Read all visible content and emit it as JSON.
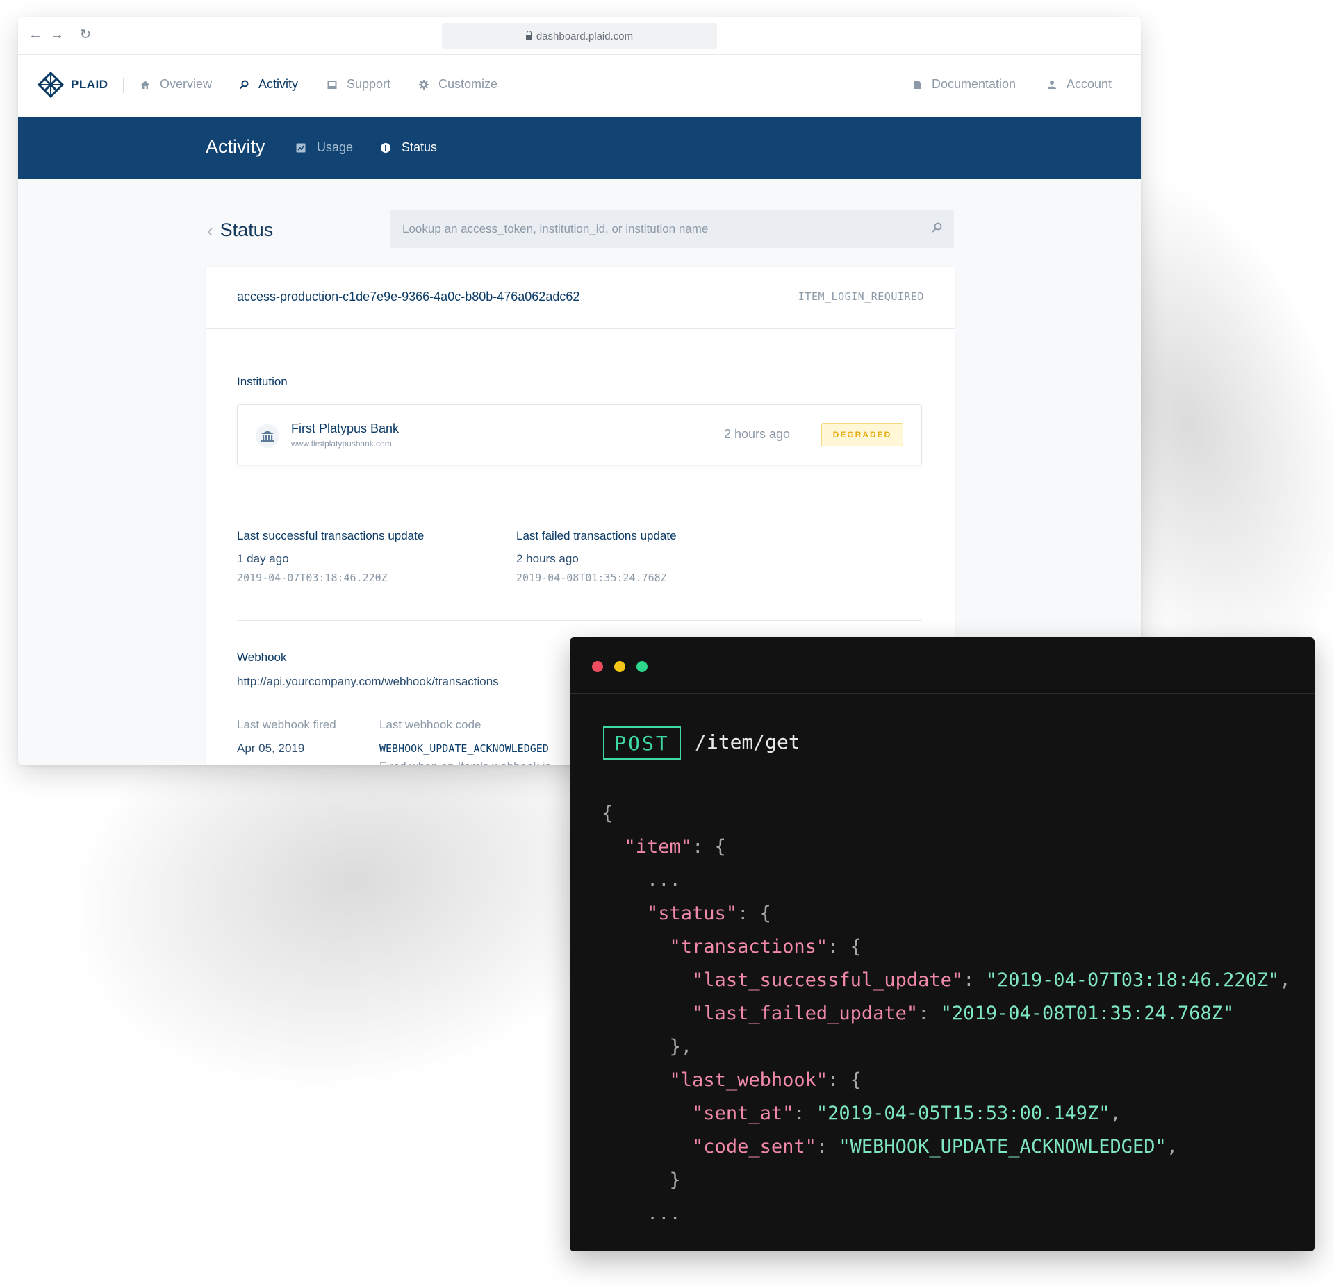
{
  "browser": {
    "url": "dashboard.plaid.com"
  },
  "topnav": {
    "brand": "PLAID",
    "items": [
      {
        "label": "Overview",
        "icon": "home-icon"
      },
      {
        "label": "Activity",
        "icon": "search-icon",
        "active": true
      },
      {
        "label": "Support",
        "icon": "support-icon"
      },
      {
        "label": "Customize",
        "icon": "gear-icon"
      }
    ],
    "right_items": [
      {
        "label": "Documentation",
        "icon": "document-icon"
      },
      {
        "label": "Account",
        "icon": "user-icon"
      }
    ]
  },
  "subbar": {
    "title": "Activity",
    "tabs": [
      {
        "label": "Usage",
        "icon": "chart-icon"
      },
      {
        "label": "Status",
        "icon": "info-icon",
        "active": true
      }
    ]
  },
  "page": {
    "title": "Status",
    "search_placeholder": "Lookup an access_token, institution_id, or institution name"
  },
  "item": {
    "access_token": "access-production-c1de7e9e-9366-4a0c-b80b-476a062adc62",
    "error_code": "ITEM_LOGIN_REQUIRED",
    "institution_label": "Institution",
    "institution": {
      "name": "First Platypus Bank",
      "url": "www.firstplatypusbank.com",
      "updated": "2 hours ago",
      "status": "DEGRADED"
    },
    "last_success": {
      "label": "Last successful transactions update",
      "relative": "1 day ago",
      "timestamp": "2019-04-07T03:18:46.220Z"
    },
    "last_failed": {
      "label": "Last failed transactions update",
      "relative": "2 hours ago",
      "timestamp": "2019-04-08T01:35:24.768Z"
    },
    "webhook": {
      "label": "Webhook",
      "url": "http://api.yourcompany.com/webhook/transactions",
      "fired_label": "Last webhook fired",
      "fired_value": "Apr 05, 2019",
      "code_label": "Last webhook code",
      "code_value": "WEBHOOK_UPDATE_ACKNOWLEDGED",
      "code_desc": "Fired when an Item's webhook is"
    }
  },
  "terminal": {
    "method": "POST",
    "endpoint": "/item/get",
    "lines": [
      {
        "indent": 0,
        "parts": [
          [
            "p",
            "{"
          ]
        ]
      },
      {
        "indent": 1,
        "parts": [
          [
            "k",
            "\"item\""
          ],
          [
            "p",
            ": {"
          ]
        ]
      },
      {
        "indent": 2,
        "parts": [
          [
            "p",
            "..."
          ]
        ]
      },
      {
        "indent": 2,
        "parts": [
          [
            "k",
            "\"status\""
          ],
          [
            "p",
            ": {"
          ]
        ]
      },
      {
        "indent": 3,
        "parts": [
          [
            "k",
            "\"transactions\""
          ],
          [
            "p",
            ": {"
          ]
        ]
      },
      {
        "indent": 4,
        "parts": [
          [
            "k",
            "\"last_successful_update\""
          ],
          [
            "p",
            ": "
          ],
          [
            "s",
            "\"2019-04-07T03:18:46.220Z\""
          ],
          [
            "p",
            ","
          ]
        ]
      },
      {
        "indent": 4,
        "parts": [
          [
            "k",
            "\"last_failed_update\""
          ],
          [
            "p",
            ": "
          ],
          [
            "s",
            "\"2019-04-08T01:35:24.768Z\""
          ]
        ]
      },
      {
        "indent": 3,
        "parts": [
          [
            "p",
            "},"
          ]
        ]
      },
      {
        "indent": 3,
        "parts": [
          [
            "k",
            "\"last_webhook\""
          ],
          [
            "p",
            ": {"
          ]
        ]
      },
      {
        "indent": 4,
        "parts": [
          [
            "k",
            "\"sent_at\""
          ],
          [
            "p",
            ": "
          ],
          [
            "s",
            "\"2019-04-05T15:53:00.149Z\""
          ],
          [
            "p",
            ","
          ]
        ]
      },
      {
        "indent": 4,
        "parts": [
          [
            "k",
            "\"code_sent\""
          ],
          [
            "p",
            ": "
          ],
          [
            "s",
            "\"WEBHOOK_UPDATE_ACKNOWLEDGED\""
          ],
          [
            "p",
            ","
          ]
        ]
      },
      {
        "indent": 3,
        "parts": [
          [
            "p",
            "}"
          ]
        ]
      },
      {
        "indent": 2,
        "parts": [
          [
            "p",
            "..."
          ]
        ]
      }
    ]
  },
  "colors": {
    "brand_navy": "#114473",
    "degraded_yellow": "#e4ab0a",
    "code_key": "#f18aa8",
    "code_string": "#7fe7c0",
    "dot_red": "#ee4d5f",
    "dot_yellow": "#f5c518",
    "dot_green": "#2fd68e"
  }
}
